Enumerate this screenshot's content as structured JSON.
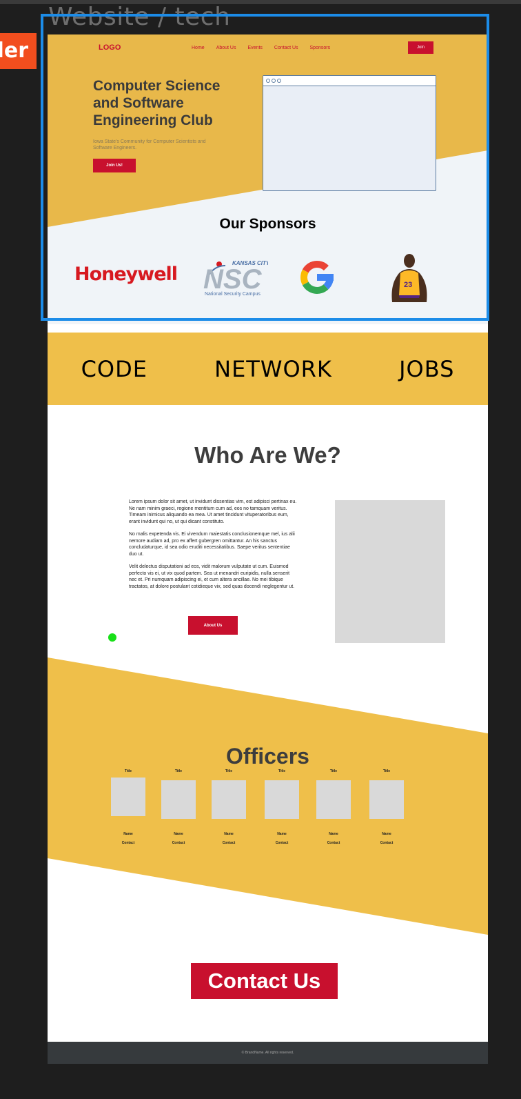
{
  "canvas": {
    "frame_label": "Website / tech",
    "side_badge": "der",
    "colors": {
      "background": "#1e1e1e",
      "selection": "#1c8ce8",
      "badge": "#f24e1e",
      "cursor": "#18e018"
    }
  },
  "site": {
    "colors": {
      "accent": "#c8102e",
      "gold": "#efbf4a",
      "hero_gold": "#e8b84a",
      "footer": "#363a3d"
    },
    "nav": {
      "logo": "LOGO",
      "links": [
        "Home",
        "About Us",
        "Events",
        "Contact Us",
        "Sponsors"
      ],
      "join": "Join"
    },
    "hero": {
      "title": "Computer Science and Software Engineering Club",
      "subtitle": "Iowa State's Community for Computer Scientists and Software Engineers.",
      "cta": "Join Us!"
    },
    "sponsors": {
      "title": "Our Sponsors",
      "honeywell": "Honeywell",
      "nsc_top": "KANSAS CITY",
      "nsc_mark": "NSC",
      "nsc_bottom": "National Security Campus",
      "jersey_number": "23"
    },
    "pillars": [
      "CODE",
      "NETWORK",
      "JOBS"
    ],
    "who": {
      "title": "Who Are We?",
      "paragraphs": [
        "Lorem ipsum dolor sit amet, ut invidunt dissentias vim, est adipisci pertinax eu. Ne nam minim graeci, regione mentitum cum ad, eos no tamquam veritus. Timeam inimicus aliquando ea mea. Ut amet tincidunt vituperatoribus eum, erant invidunt qui no, ut qui dicant constituto.",
        "No malis expetenda vis. Ei vivendum maiestatis conclusionemque mel, ius alii nemore audiam ad, pro ex affert gubergren omittantur. An his sanctus concludaturque, id sea odio eruditi necessitatibus. Saepe veritus sententiae duo ut.",
        "Velit delectus disputationi ad eos, vidit malorum vulputate ut cum. Euismod perfecto vis ei, ut vix quod partem. Sea ut menandri euripidis, nulla senserit nec et. Pri numquam adipiscing ei, et cum altera ancillae. No mei tibique tractatos, at dolore postulant cotidieque vix, sed quas docendi neglegentur ut."
      ],
      "button": "About Us"
    },
    "officers": {
      "title": "Officers",
      "list": [
        {
          "title": "Title",
          "name": "Name",
          "contact": "Contact"
        },
        {
          "title": "Title",
          "name": "Name",
          "contact": "Contact"
        },
        {
          "title": "Title",
          "name": "Name",
          "contact": "Contact"
        },
        {
          "title": "Title",
          "name": "Name",
          "contact": "Contact"
        },
        {
          "title": "Title",
          "name": "Name",
          "contact": "Contact"
        },
        {
          "title": "Title",
          "name": "Name",
          "contact": "Contact"
        }
      ]
    },
    "contact_button": "Contact Us",
    "footer": "© BrandName. All rights reserved."
  }
}
